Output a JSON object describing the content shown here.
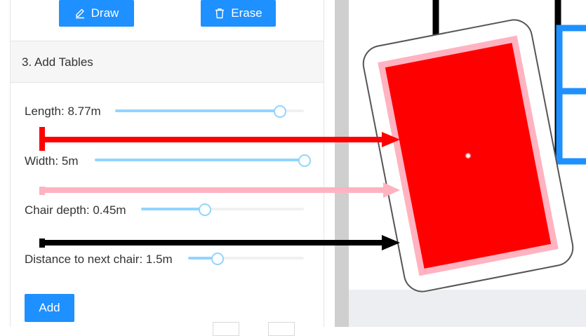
{
  "toolbar": {
    "draw_label": "Draw",
    "erase_label": "Erase",
    "draw_icon": "pencil-icon",
    "erase_icon": "trash-icon"
  },
  "section": {
    "title": "3. Add Tables"
  },
  "controls": {
    "length": {
      "label": "Length: 8.77m",
      "fraction": 0.87
    },
    "width": {
      "label": "Width: 5m",
      "fraction": 1.0
    },
    "chair_depth": {
      "label": "Chair depth: 0.45m",
      "fraction": 0.39
    },
    "chair_distance": {
      "label": "Distance to next chair: 1.5m",
      "fraction": 0.25
    }
  },
  "add_button": {
    "label": "Add"
  },
  "colors": {
    "primary": "#1e90ff",
    "slider_fill": "#91d5ff",
    "table_fill": "#ff0000",
    "chair_band": "#ffb3c1",
    "arrow_length": "#ff0000",
    "arrow_width": "#ffb3c1",
    "arrow_chair": "#000000"
  }
}
